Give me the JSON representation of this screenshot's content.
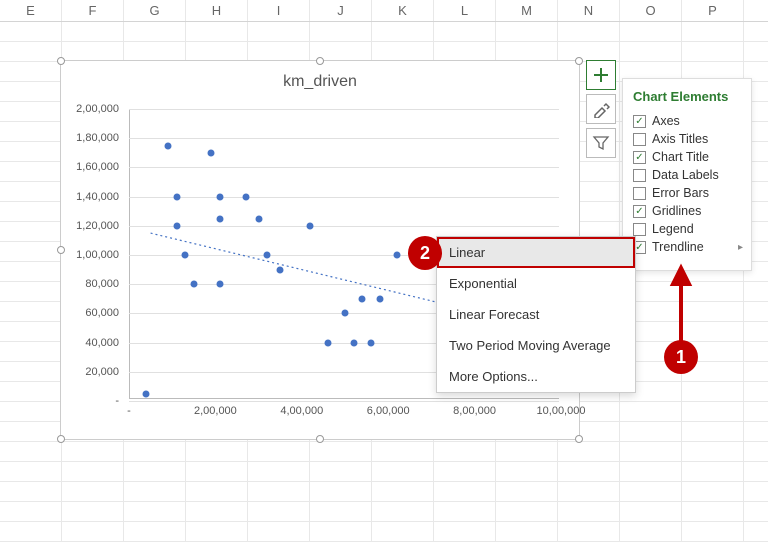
{
  "columns": [
    "E",
    "F",
    "G",
    "H",
    "I",
    "J",
    "K",
    "L",
    "M",
    "N",
    "O",
    "P"
  ],
  "chart_data": {
    "type": "scatter",
    "title": "km_driven",
    "xlabel": "",
    "ylabel": "",
    "xlim": [
      0,
      1000000
    ],
    "ylim": [
      0,
      200000
    ],
    "x_ticks": [
      {
        "v": 0,
        "label": "-"
      },
      {
        "v": 200000,
        "label": "2,00,000"
      },
      {
        "v": 400000,
        "label": "4,00,000"
      },
      {
        "v": 600000,
        "label": "6,00,000"
      },
      {
        "v": 800000,
        "label": "8,00,000"
      },
      {
        "v": 1000000,
        "label": "10,00,000"
      }
    ],
    "y_ticks": [
      {
        "v": 0,
        "label": "-"
      },
      {
        "v": 20000,
        "label": "20,000"
      },
      {
        "v": 40000,
        "label": "40,000"
      },
      {
        "v": 60000,
        "label": "60,000"
      },
      {
        "v": 80000,
        "label": "80,000"
      },
      {
        "v": 100000,
        "label": "1,00,000"
      },
      {
        "v": 120000,
        "label": "1,20,000"
      },
      {
        "v": 140000,
        "label": "1,40,000"
      },
      {
        "v": 160000,
        "label": "1,60,000"
      },
      {
        "v": 180000,
        "label": "1,80,000"
      },
      {
        "v": 200000,
        "label": "2,00,000"
      }
    ],
    "series": [
      {
        "name": "km_driven",
        "points": [
          {
            "x": 40000,
            "y": 5000
          },
          {
            "x": 90000,
            "y": 175000
          },
          {
            "x": 110000,
            "y": 140000
          },
          {
            "x": 110000,
            "y": 120000
          },
          {
            "x": 130000,
            "y": 100000
          },
          {
            "x": 150000,
            "y": 80000
          },
          {
            "x": 190000,
            "y": 170000
          },
          {
            "x": 210000,
            "y": 140000
          },
          {
            "x": 210000,
            "y": 125000
          },
          {
            "x": 210000,
            "y": 80000
          },
          {
            "x": 270000,
            "y": 140000
          },
          {
            "x": 300000,
            "y": 125000
          },
          {
            "x": 320000,
            "y": 100000
          },
          {
            "x": 350000,
            "y": 90000
          },
          {
            "x": 420000,
            "y": 120000
          },
          {
            "x": 460000,
            "y": 40000
          },
          {
            "x": 500000,
            "y": 60000
          },
          {
            "x": 520000,
            "y": 40000
          },
          {
            "x": 540000,
            "y": 70000
          },
          {
            "x": 560000,
            "y": 40000
          },
          {
            "x": 580000,
            "y": 70000
          },
          {
            "x": 620000,
            "y": 100000
          },
          {
            "x": 780000,
            "y": 60000
          }
        ]
      }
    ],
    "trendline": {
      "type": "linear",
      "x1": 50000,
      "y1": 115000,
      "x2": 820000,
      "y2": 60000
    }
  },
  "side_buttons": [
    {
      "icon": "plus",
      "active": true
    },
    {
      "icon": "brush",
      "active": false
    },
    {
      "icon": "filter",
      "active": false
    }
  ],
  "elements_panel": {
    "title": "Chart Elements",
    "items": [
      {
        "label": "Axes",
        "checked": true,
        "submenu": false
      },
      {
        "label": "Axis Titles",
        "checked": false,
        "submenu": false
      },
      {
        "label": "Chart Title",
        "checked": true,
        "submenu": false
      },
      {
        "label": "Data Labels",
        "checked": false,
        "submenu": false
      },
      {
        "label": "Error Bars",
        "checked": false,
        "submenu": false
      },
      {
        "label": "Gridlines",
        "checked": true,
        "submenu": false
      },
      {
        "label": "Legend",
        "checked": false,
        "submenu": false
      },
      {
        "label": "Trendline",
        "checked": true,
        "submenu": true
      }
    ]
  },
  "trendline_menu": {
    "items": [
      {
        "label": "Linear",
        "highlight": true
      },
      {
        "label": "Exponential",
        "highlight": false
      },
      {
        "label": "Linear Forecast",
        "highlight": false
      },
      {
        "label": "Two Period Moving Average",
        "highlight": false
      },
      {
        "label": "More Options...",
        "highlight": false
      }
    ]
  },
  "callouts": {
    "c1": "1",
    "c2": "2"
  }
}
